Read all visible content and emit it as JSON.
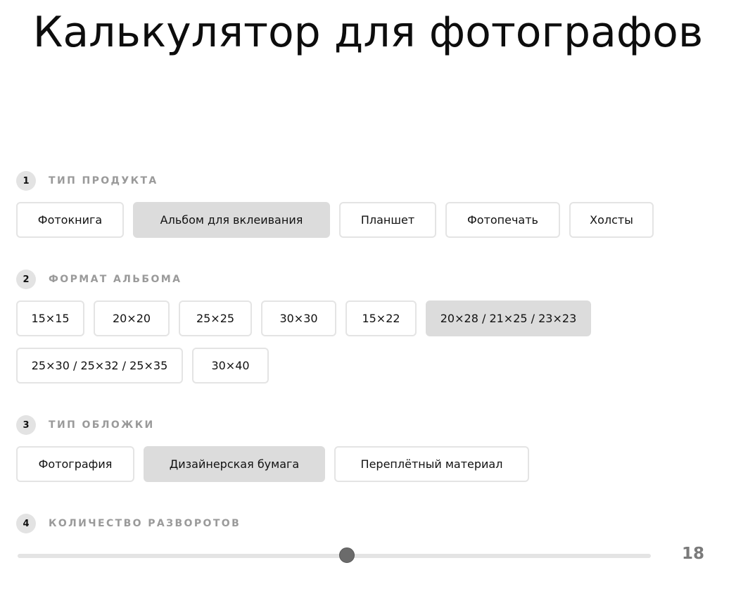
{
  "title": "Калькулятор для фотографов",
  "sections": [
    {
      "num": "1",
      "label": "ТИП ПРОДУКТА",
      "options": [
        {
          "label": "Фотокнига",
          "selected": false
        },
        {
          "label": "Альбом для вклеивания",
          "selected": true
        },
        {
          "label": "Планшет",
          "selected": false
        },
        {
          "label": "Фотопечать",
          "selected": false
        },
        {
          "label": "Холсты",
          "selected": false
        }
      ]
    },
    {
      "num": "2",
      "label": "ФОРМАТ АЛЬБОМА",
      "options": [
        {
          "label": "15×15",
          "selected": false
        },
        {
          "label": "20×20",
          "selected": false
        },
        {
          "label": "25×25",
          "selected": false
        },
        {
          "label": "30×30",
          "selected": false
        },
        {
          "label": "15×22",
          "selected": false
        },
        {
          "label": "20×28 / 21×25 / 23×23",
          "selected": true
        },
        {
          "label": "25×30 / 25×32 / 25×35",
          "selected": false
        },
        {
          "label": "30×40",
          "selected": false
        }
      ]
    },
    {
      "num": "3",
      "label": "ТИП ОБЛОЖКИ",
      "options": [
        {
          "label": "Фотография",
          "selected": false
        },
        {
          "label": "Дизайнерская бумага",
          "selected": true
        },
        {
          "label": "Переплётный материал",
          "selected": false
        }
      ]
    },
    {
      "num": "4",
      "label": "КОЛИЧЕСТВО РАЗВОРОТОВ"
    }
  ],
  "spreads": {
    "value": "18",
    "fraction": 0.52
  },
  "colors": {
    "selected_bg": "#dcdcdc",
    "border": "#e4e4e4",
    "label_gray": "#9a9a9a",
    "thumb": "#6b6b6b"
  }
}
